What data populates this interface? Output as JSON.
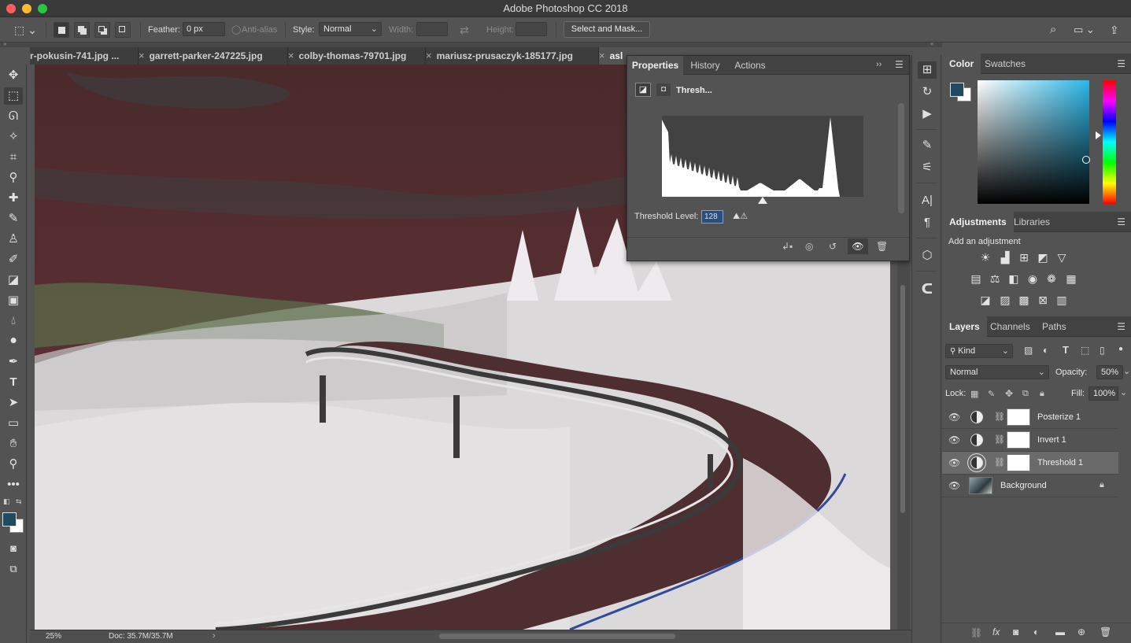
{
  "window": {
    "title": "Adobe Photoshop CC 2018"
  },
  "options_bar": {
    "feather_label": "Feather:",
    "feather_value": "0 px",
    "anti_alias_label": "Anti-alias",
    "style_label": "Style:",
    "style_value": "Normal",
    "width_label": "Width:",
    "height_label": "Height:",
    "select_mask_button": "Select and Mask..."
  },
  "document_tabs": [
    {
      "label": "r-pokusin-741.jpg ..."
    },
    {
      "label": "garrett-parker-247225.jpg"
    },
    {
      "label": "colby-thomas-79701.jpg"
    },
    {
      "label": "mariusz-prusaczyk-185177.jpg"
    },
    {
      "label": "asl"
    }
  ],
  "status": {
    "zoom": "25%",
    "doc": "Doc: 35.7M/35.7M"
  },
  "properties_panel": {
    "tabs": [
      "Properties",
      "History",
      "Actions"
    ],
    "adjustment_name": "Thresh...",
    "threshold_label": "Threshold Level:",
    "threshold_value": "128",
    "histogram_slider_pos": 0.5
  },
  "color_panel": {
    "tabs": [
      "Color",
      "Swatches"
    ],
    "foreground": "#1f4a60",
    "background": "#ffffff"
  },
  "adjustments_panel": {
    "tabs": [
      "Adjustments",
      "Libraries"
    ],
    "hint": "Add an adjustment"
  },
  "layers_panel": {
    "tabs": [
      "Layers",
      "Channels",
      "Paths"
    ],
    "filter_kind": "Kind",
    "blend_mode": "Normal",
    "opacity_label": "Opacity:",
    "opacity_value": "50%",
    "lock_label": "Lock:",
    "fill_label": "Fill:",
    "fill_value": "100%",
    "layers": [
      {
        "name": "Posterize 1",
        "type": "adjustment"
      },
      {
        "name": "Invert 1",
        "type": "adjustment"
      },
      {
        "name": "Threshold 1",
        "type": "adjustment",
        "selected": true
      },
      {
        "name": "Background",
        "type": "image",
        "locked": true
      }
    ]
  },
  "colors": {
    "accent_blue": "#1f4a60",
    "road_blue": "#2f4a9e"
  }
}
